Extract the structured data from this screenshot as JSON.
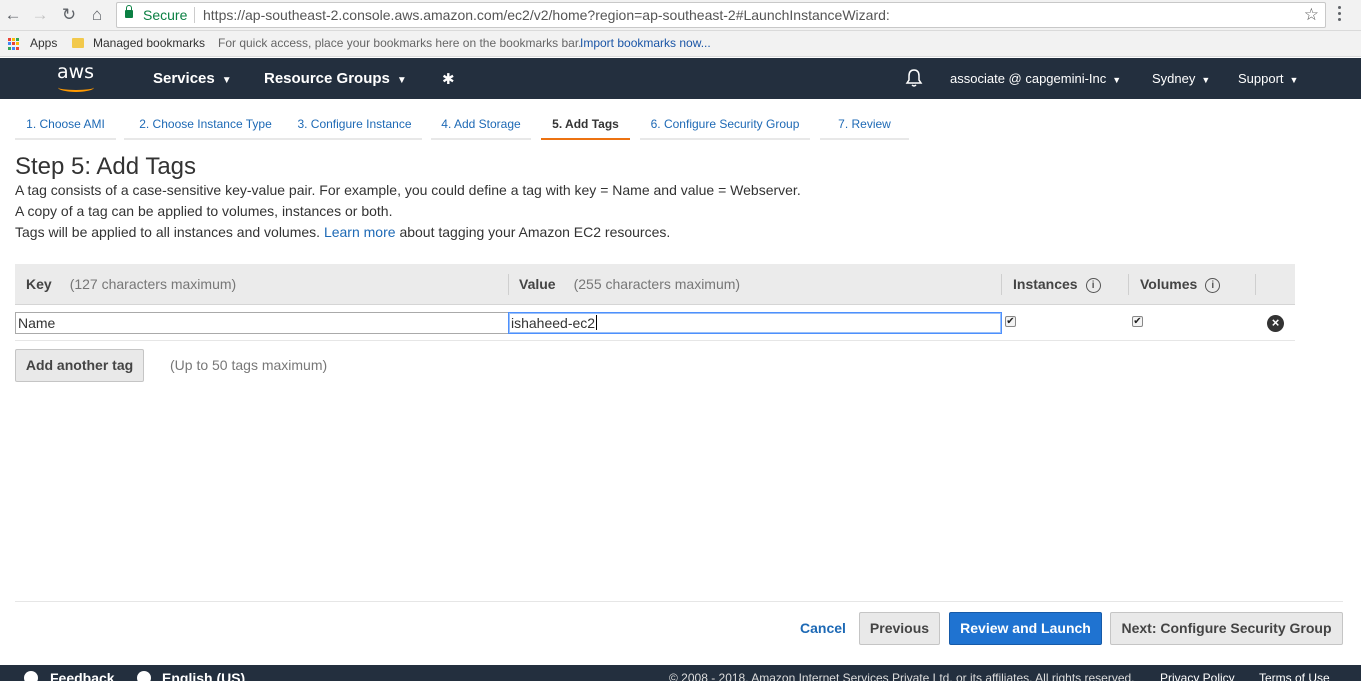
{
  "browser": {
    "secure_label": "Secure",
    "url": "https://ap-southeast-2.console.aws.amazon.com/ec2/v2/home?region=ap-southeast-2#LaunchInstanceWizard:"
  },
  "bookmarks": {
    "apps_label": "Apps",
    "managed_label": "Managed bookmarks",
    "hint": "For quick access, place your bookmarks here on the bookmarks bar.",
    "import_label": "Import bookmarks now..."
  },
  "aws_nav": {
    "logo_text": "aws",
    "services_label": "Services",
    "resource_groups_label": "Resource Groups",
    "account_label": "associate @ capgemini-Inc",
    "region_label": "Sydney",
    "support_label": "Support"
  },
  "wizard": {
    "tabs": [
      {
        "label": "1. Choose AMI"
      },
      {
        "label": "2. Choose Instance Type"
      },
      {
        "label": "3. Configure Instance"
      },
      {
        "label": "4. Add Storage"
      },
      {
        "label": "5. Add Tags",
        "active": true
      },
      {
        "label": "6. Configure Security Group"
      },
      {
        "label": "7. Review"
      }
    ],
    "title": "Step 5: Add Tags",
    "desc_line1": "A tag consists of a case-sensitive key-value pair. For example, you could define a tag with key = Name and value = Webserver.",
    "desc_line2": "A copy of a tag can be applied to volumes, instances or both.",
    "desc_line3_prefix": "Tags will be applied to all instances and volumes.",
    "learn_more": "Learn more",
    "desc_line3_suffix": "about tagging your Amazon EC2 resources."
  },
  "table": {
    "key_header": "Key",
    "key_sub": "(127 characters maximum)",
    "value_header": "Value",
    "value_sub": "(255 characters maximum)",
    "instances_header": "Instances",
    "volumes_header": "Volumes",
    "rows": [
      {
        "key": "Name",
        "value": "ishaheed-ec2",
        "instances": true,
        "volumes": true
      }
    ]
  },
  "actions": {
    "add_tag_label": "Add another tag",
    "add_tag_hint": "(Up to 50 tags maximum)",
    "cancel_label": "Cancel",
    "previous_label": "Previous",
    "review_launch_label": "Review and Launch",
    "next_label": "Next: Configure Security Group"
  },
  "footer": {
    "feedback_label": "Feedback",
    "language_label": "English (US)",
    "copyright": "© 2008 - 2018, Amazon Internet Services Private Ltd. or its affiliates. All rights reserved.",
    "privacy_label": "Privacy Policy",
    "terms_label": "Terms of Use"
  }
}
